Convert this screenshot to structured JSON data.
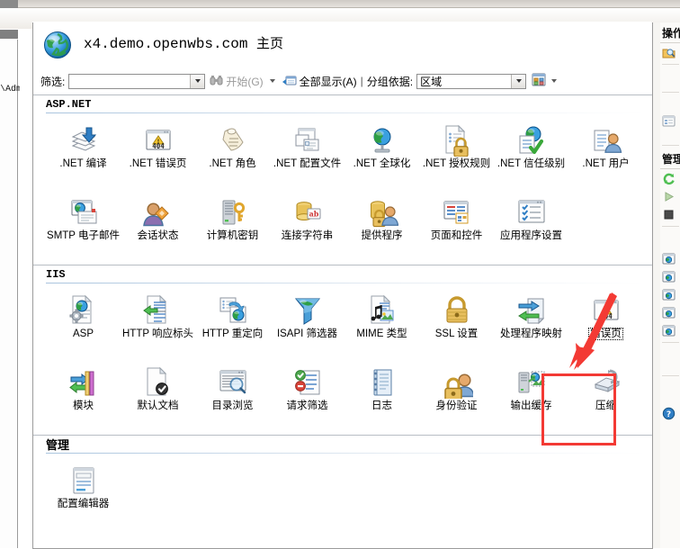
{
  "window": {
    "title_host": "x4.demo.openwbs.com",
    "title_suffix": "主页",
    "globe_icon": "globe-icon"
  },
  "left_tree": {
    "truncated_label": "\\Adm"
  },
  "filter_bar": {
    "label": "筛选:",
    "filter_value": "",
    "filter_placeholder": "",
    "start_button": "开始(G)",
    "start_icon": "binoculars-icon",
    "show_all_button": "全部显示(A)",
    "show_all_icon": "show-all-icon",
    "separator": "|",
    "group_by_label": "分组依据:",
    "group_by_value": "区域",
    "view_icon": "view-mode-icon"
  },
  "groups": [
    {
      "name": "ASP.NET",
      "mono_heading": true,
      "items": [
        {
          "label": ".NET 编译",
          "icon": "net-compilation-icon"
        },
        {
          "label": ".NET 错误页",
          "icon": "net-error-pages-icon"
        },
        {
          "label": ".NET 角色",
          "icon": "net-roles-icon"
        },
        {
          "label": ".NET 配置文件",
          "icon": "net-profile-icon"
        },
        {
          "label": ".NET 全球化",
          "icon": "net-globalization-icon"
        },
        {
          "label": ".NET 授权规则",
          "icon": "net-authorization-rules-icon"
        },
        {
          "label": ".NET 信任级别",
          "icon": "net-trust-levels-icon"
        },
        {
          "label": ".NET 用户",
          "icon": "net-users-icon"
        },
        {
          "label": "SMTP 电子邮件",
          "icon": "smtp-email-icon"
        },
        {
          "label": "会话状态",
          "icon": "session-state-icon"
        },
        {
          "label": "计算机密钥",
          "icon": "machine-key-icon"
        },
        {
          "label": "连接字符串",
          "icon": "connection-strings-icon"
        },
        {
          "label": "提供程序",
          "icon": "providers-icon"
        },
        {
          "label": "页面和控件",
          "icon": "pages-and-controls-icon"
        },
        {
          "label": "应用程序设置",
          "icon": "application-settings-icon"
        }
      ]
    },
    {
      "name": "IIS",
      "mono_heading": true,
      "items": [
        {
          "label": "ASP",
          "icon": "asp-icon"
        },
        {
          "label": "HTTP 响应标头",
          "icon": "http-response-headers-icon"
        },
        {
          "label": "HTTP 重定向",
          "icon": "http-redirect-icon"
        },
        {
          "label": "ISAPI 筛选器",
          "icon": "isapi-filters-icon"
        },
        {
          "label": "MIME 类型",
          "icon": "mime-types-icon"
        },
        {
          "label": "SSL 设置",
          "icon": "ssl-settings-icon"
        },
        {
          "label": "处理程序映射",
          "icon": "handler-mappings-icon"
        },
        {
          "label": "错误页",
          "icon": "error-pages-icon",
          "selected": true,
          "highlighted": true
        },
        {
          "label": "模块",
          "icon": "modules-icon"
        },
        {
          "label": "默认文档",
          "icon": "default-document-icon"
        },
        {
          "label": "目录浏览",
          "icon": "directory-browsing-icon"
        },
        {
          "label": "请求筛选",
          "icon": "request-filtering-icon"
        },
        {
          "label": "日志",
          "icon": "logging-icon"
        },
        {
          "label": "身份验证",
          "icon": "authentication-icon"
        },
        {
          "label": "输出缓存",
          "icon": "output-caching-icon"
        },
        {
          "label": "压缩",
          "icon": "compression-icon"
        }
      ]
    },
    {
      "name": "管理",
      "mono_heading": false,
      "items": [
        {
          "label": "配置编辑器",
          "icon": "configuration-editor-icon"
        }
      ]
    }
  ],
  "actions_pane": {
    "heading_actions": "操作",
    "heading_manage": "管理",
    "items": [
      {
        "icon": "open-feature-icon"
      },
      {
        "icon": "view-list-icon"
      },
      {
        "icon": "restart-icon"
      },
      {
        "icon": "start-icon"
      },
      {
        "icon": "stop-icon"
      },
      {
        "icon": "browse-website-icon"
      },
      {
        "icon": "browse-website-icon"
      },
      {
        "icon": "browse-website-icon"
      },
      {
        "icon": "browse-website-icon"
      },
      {
        "icon": "browse-website-icon"
      },
      {
        "icon": "help-icon"
      }
    ]
  },
  "annotation": {
    "highlight_color": "#f33a34",
    "arrow_color": "#f33a34",
    "target_label": "错误页"
  }
}
